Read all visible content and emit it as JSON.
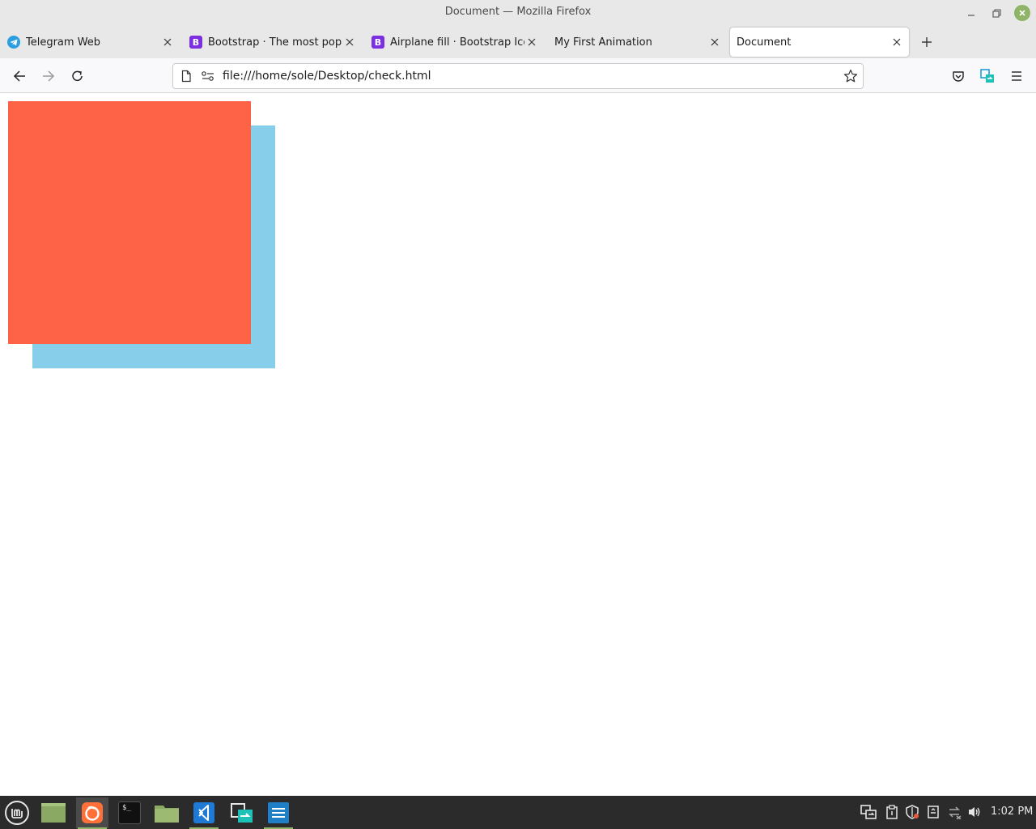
{
  "window": {
    "title": "Document — Mozilla Firefox"
  },
  "tabs": [
    {
      "label": "Telegram Web",
      "favicon": "telegram-icon"
    },
    {
      "label": "Bootstrap · The most popular",
      "favicon": "bootstrap-icon"
    },
    {
      "label": "Airplane fill · Bootstrap Icons",
      "favicon": "bootstrap-icon"
    },
    {
      "label": "My First Animation",
      "favicon": "none"
    },
    {
      "label": "Document",
      "favicon": "none",
      "active": true
    }
  ],
  "bootstrap_favicon_letter": "B",
  "navbar": {
    "url": "file:///home/sole/Desktop/check.html"
  },
  "page": {
    "boxes": [
      {
        "name": "blue-square",
        "color": "#87CEEB"
      },
      {
        "name": "red-square",
        "color": "#FF6347"
      }
    ]
  },
  "taskbar": {
    "apps": [
      "mint-menu-icon",
      "show-desktop-icon",
      "firefox-icon",
      "terminal-icon",
      "files-icon",
      "vscode-icon",
      "transfer-app-icon",
      "text-editor-icon"
    ],
    "terminal_glyph": "$_",
    "clock": "1:02 PM"
  },
  "colors": {
    "accent": "#8fb467",
    "titlebar": "#e8e8e8",
    "taskbar": "#2b2b2b"
  }
}
